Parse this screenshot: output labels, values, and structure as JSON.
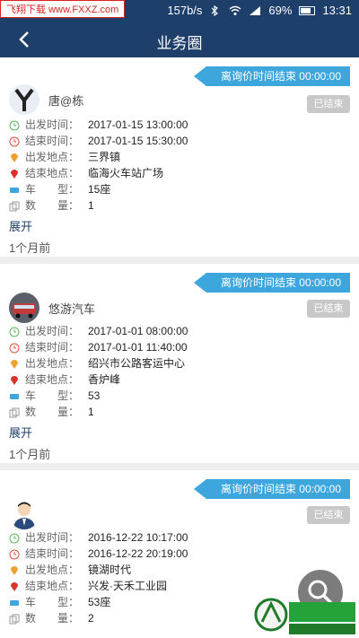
{
  "status": {
    "watermark": "飞翔下载 www.FXXZ.com",
    "speed": "157b/s",
    "battery": "69%",
    "time": "13:31"
  },
  "header": {
    "title": "业务圈"
  },
  "labels": {
    "start_time": "出发时间：",
    "end_time": "结束时间：",
    "start_place": "出发地点：",
    "end_place": "结束地点：",
    "car_type": "车　　型：",
    "quantity": "数　　量：",
    "expand": "展开",
    "ended": "已结束"
  },
  "cards": [
    {
      "timer": "离询价时间结束 00:00:00",
      "user": "唐@栋",
      "start_time": "2017-01-15 13:00:00",
      "end_time": "2017-01-15 15:30:00",
      "start_place": "三界镇",
      "end_place": "临海火车站广场",
      "car_type": "15座",
      "quantity": "1",
      "ago": "1个月前"
    },
    {
      "timer": "离询价时间结束 00:00:00",
      "user": "悠游汽车",
      "start_time": "2017-01-01 08:00:00",
      "end_time": "2017-01-01 11:40:00",
      "start_place": "绍兴市公路客运中心",
      "end_place": "香炉峰",
      "car_type": "53",
      "quantity": "1",
      "ago": "1个月前"
    },
    {
      "timer": "离询价时间结束 00:00:00",
      "user": "",
      "start_time": "2016-12-22 10:17:00",
      "end_time": "2016-12-22 20:19:00",
      "start_place": "镜湖时代",
      "end_place": "兴发·天禾工业园",
      "car_type": "53座",
      "quantity": "2",
      "ago": ""
    }
  ],
  "watermark_bottom": "飞翔下载 www.FXXZ.com",
  "colors": {
    "header": "#1f3f6b",
    "timer": "#3da6dc",
    "ended_badge": "#c8c8c8"
  }
}
